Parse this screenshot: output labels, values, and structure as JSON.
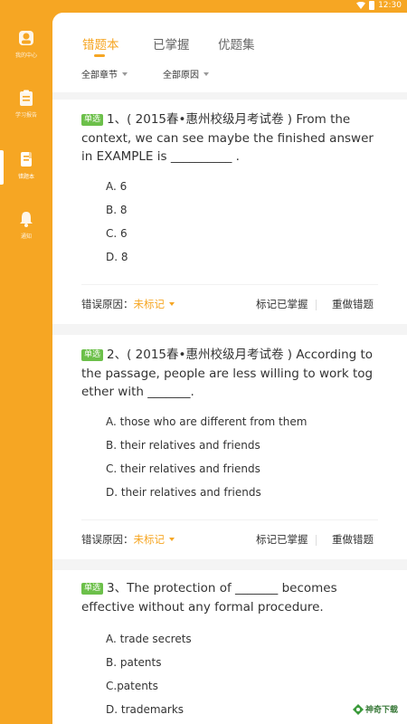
{
  "status_bar": {
    "time": "12:30"
  },
  "sidebar": {
    "items": [
      {
        "label": "我的中心",
        "icon": "user-avatar-icon"
      },
      {
        "label": "学习报告",
        "icon": "clipboard-icon"
      },
      {
        "label": "错题本",
        "icon": "notebook-icon",
        "active": true
      },
      {
        "label": "通知",
        "icon": "bell-icon"
      }
    ]
  },
  "tabs": [
    "错题本",
    "已掌握",
    "优题集"
  ],
  "filters": {
    "chapter": "全部章节",
    "reason": "全部原因"
  },
  "questions": [
    {
      "badge": "单选",
      "text": "1、( 2015春•惠州校级月考试卷 ) From the context, we can see maybe the finished answer in EXAMPLE is __________ .",
      "options": [
        "A. 6",
        "B. 8",
        "C. 6",
        "D. 8"
      ],
      "footer": {
        "reason_label": "错误原因：",
        "reason_value": "未标记",
        "mark_btn": "标记已掌握",
        "redo_btn": "重做错题"
      }
    },
    {
      "badge": "单选",
      "text": "2、( 2015春•惠州校级月考试卷 ) According to the passage, people are less willing to work tog ether with _______.",
      "options": [
        "A. those who are different from them",
        "B. their relatives and friends",
        "C. their relatives and friends",
        "D. their relatives and friends"
      ],
      "footer": {
        "reason_label": "错误原因：",
        "reason_value": "未标记",
        "mark_btn": "标记已掌握",
        "redo_btn": "重做错题"
      }
    },
    {
      "badge": "单选",
      "text": "3、The protection of _______ becomes effective without any formal procedure.",
      "options": [
        "A. trade secrets",
        "B. patents",
        "C.patents",
        "D. trademarks"
      ]
    }
  ],
  "watermark": "神奇下载",
  "colors": {
    "accent": "#f6a623",
    "badge_green": "#6cc04a",
    "background": "#f4f4f4"
  }
}
